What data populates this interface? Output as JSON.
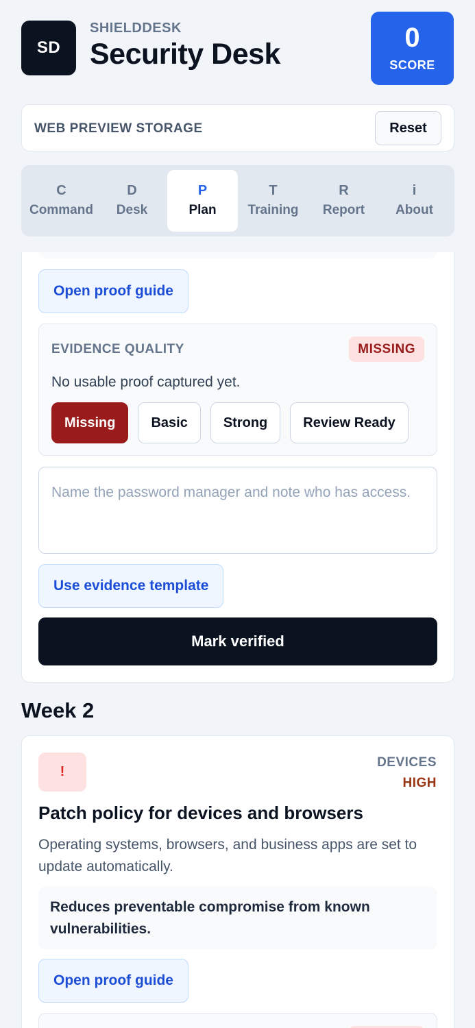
{
  "header": {
    "logo_text": "SD",
    "kicker": "SHIELDDESK",
    "title": "Security Desk",
    "score_value": "0",
    "score_label": "SCORE"
  },
  "storage": {
    "label": "WEB PREVIEW STORAGE",
    "reset_label": "Reset"
  },
  "tabs": [
    {
      "key": "C",
      "label": "Command",
      "active": false
    },
    {
      "key": "D",
      "label": "Desk",
      "active": false
    },
    {
      "key": "P",
      "label": "Plan",
      "active": true
    },
    {
      "key": "T",
      "label": "Training",
      "active": false
    },
    {
      "key": "R",
      "label": "Report",
      "active": false
    },
    {
      "key": "i",
      "label": "About",
      "active": false
    }
  ],
  "current_task": {
    "proof_guide_label": "Open proof guide",
    "evidence": {
      "title": "EVIDENCE QUALITY",
      "badge": "MISSING",
      "status_text": "No usable proof captured yet.",
      "options": [
        "Missing",
        "Basic",
        "Strong",
        "Review Ready"
      ],
      "selected": "Missing"
    },
    "notes_placeholder": "Name the password manager and note who has access.",
    "template_label": "Use evidence template",
    "verify_label": "Mark verified"
  },
  "week2": {
    "title": "Week 2",
    "task": {
      "icon": "!",
      "category": "DEVICES",
      "priority": "HIGH",
      "title": "Patch policy for devices and browsers",
      "description": "Operating systems, browsers, and business apps are set to update automatically.",
      "impact": "Reduces preventable compromise from known vulnerabilities.",
      "proof_guide_label": "Open proof guide"
    }
  },
  "colors": {
    "accent": "#2563eb",
    "danger": "#991b1b",
    "dark": "#0b1220",
    "priority_high": "#9a3412"
  }
}
